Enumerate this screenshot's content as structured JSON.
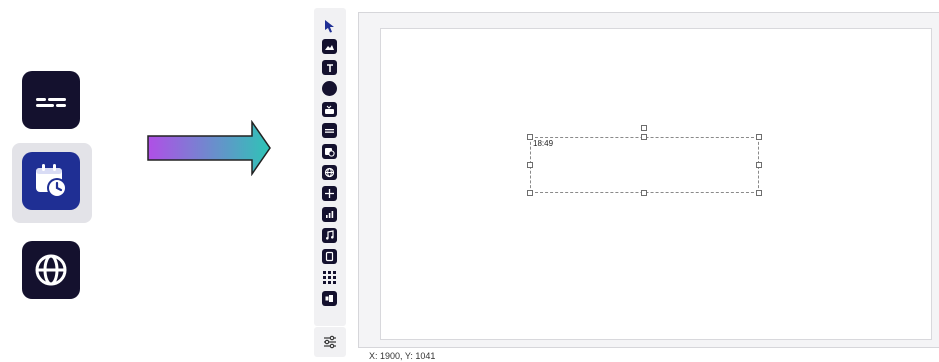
{
  "left_icons": [
    {
      "name": "text-element-icon"
    },
    {
      "name": "date-time-icon",
      "selected": true
    },
    {
      "name": "web-element-icon"
    }
  ],
  "arrow": {
    "gradient_from": "#b04fe6",
    "gradient_to": "#2ec4b6"
  },
  "toolbar": {
    "items": [
      "pointer-tool",
      "image-tool",
      "text-tool",
      "shape-tool",
      "youtube-tool",
      "text-strip-tool",
      "datetime-tool",
      "web-tool",
      "grid-tool",
      "chart-tool",
      "audio-tool",
      "tv-tool",
      "table-tool",
      "document-tool"
    ],
    "settings": "settings-icon"
  },
  "canvas": {
    "element_text": "18:49",
    "coords": "X: 1900, Y: 1041"
  },
  "colors": {
    "icon_dark": "#14112e",
    "icon_selected": "#1f2f94"
  }
}
